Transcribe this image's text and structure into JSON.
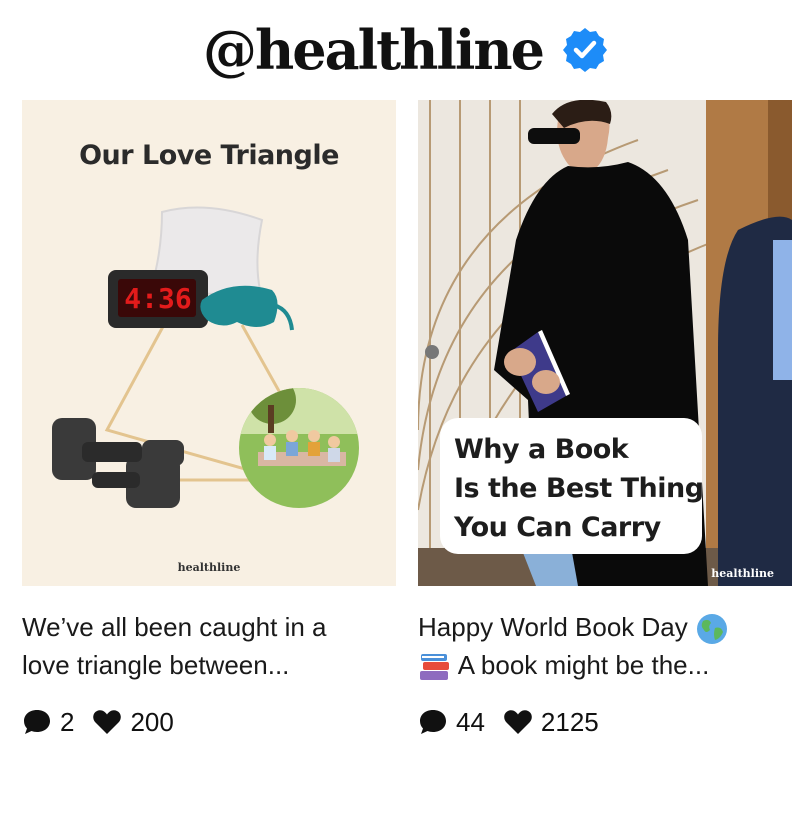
{
  "header": {
    "handle": "@healthline",
    "verified_icon": "verified-badge-icon",
    "verified_color": "#1d8cf8"
  },
  "posts": [
    {
      "image": {
        "title": "Our Love Triangle",
        "clock_time": "4:36",
        "brand": "healthline",
        "background": "#f8f0e3"
      },
      "caption_line1": "We’ve all been caught in a",
      "caption_line2": "love triangle between...",
      "comments": "2",
      "likes": "200"
    },
    {
      "image": {
        "callout_line1": "Why a Book",
        "callout_line2": "Is the Best Thing",
        "callout_line3": "You Can Carry",
        "brand": "healthline"
      },
      "caption_line1": "Happy World Book Day",
      "caption_line2": "A book might be the...",
      "caption_emoji1": "globe-icon",
      "caption_emoji2": "books-icon",
      "comments": "44",
      "likes": "2125"
    }
  ],
  "icons": {
    "comment": "comment-bubble-icon",
    "like": "heart-icon"
  }
}
